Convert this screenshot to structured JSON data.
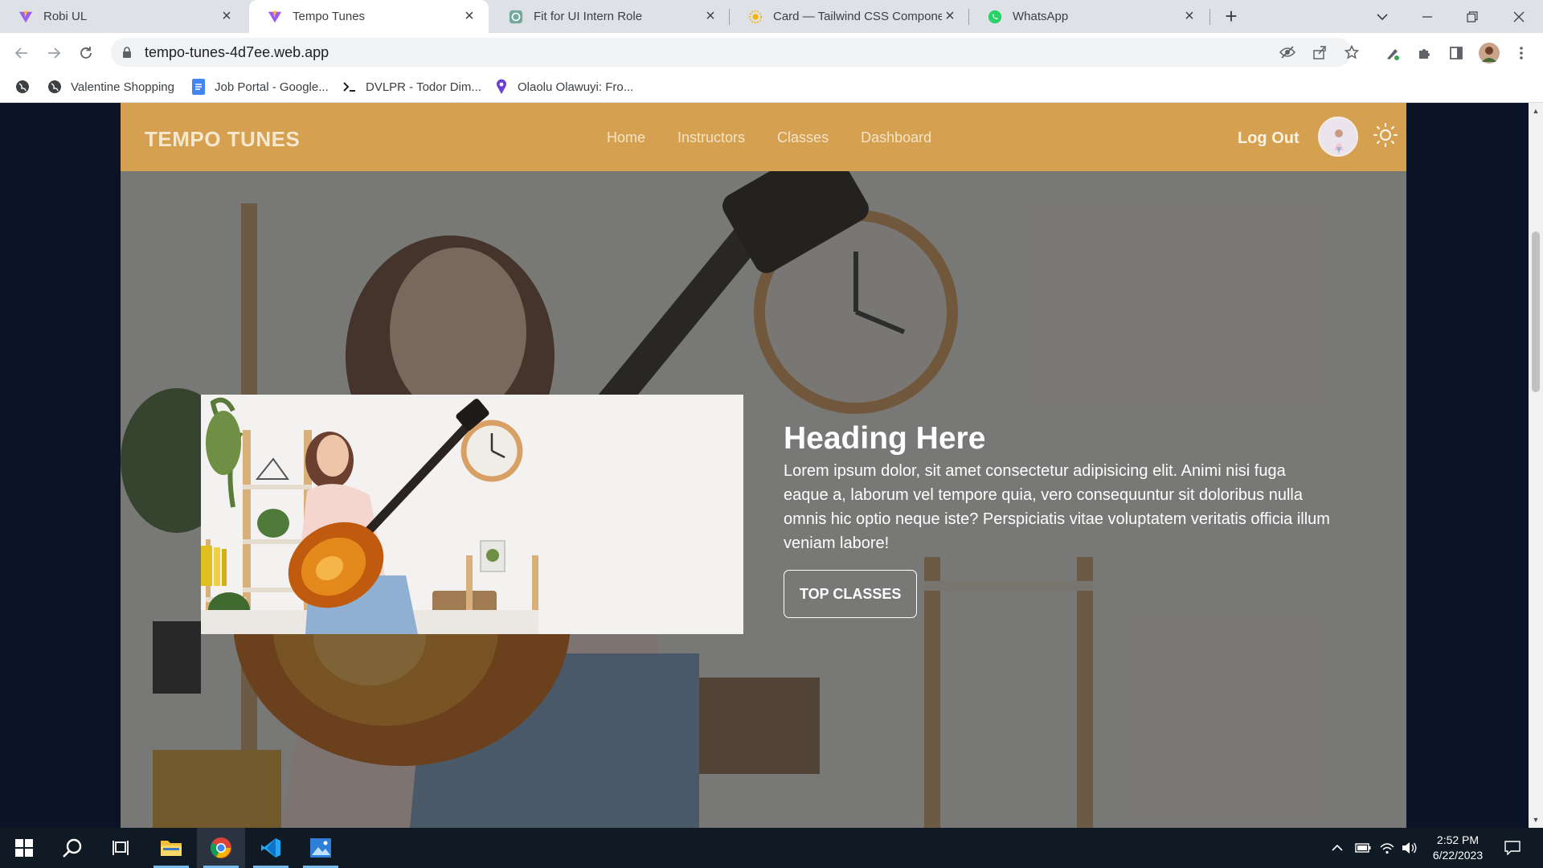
{
  "browser": {
    "tabs": [
      {
        "label": "Robi UL",
        "icon": "vite-icon"
      },
      {
        "label": "Tempo Tunes",
        "icon": "vite-icon",
        "active": true
      },
      {
        "label": "Fit for UI Intern Role",
        "icon": "chatgpt-icon"
      },
      {
        "label": "Card — Tailwind CSS Components",
        "icon": "daisyui-icon"
      },
      {
        "label": "WhatsApp",
        "icon": "whatsapp-icon"
      }
    ],
    "url": "tempo-tunes-4d7ee.web.app",
    "bookmarks": [
      {
        "label": "",
        "icon": "globe-icon"
      },
      {
        "label": "Valentine Shopping",
        "icon": "globe-icon"
      },
      {
        "label": "Job Portal - Google...",
        "icon": "docs-icon"
      },
      {
        "label": "DVLPR - Todor Dim...",
        "icon": "terminal-icon"
      },
      {
        "label": "Olaolu Olawuyi: Fro...",
        "icon": "location-icon"
      }
    ]
  },
  "site": {
    "logo": "TEMPO TUNES",
    "nav": [
      "Home",
      "Instructors",
      "Classes",
      "Dashboard"
    ],
    "logout": "Log Out",
    "accent": "#d6a051"
  },
  "hero": {
    "title": "Heading Here",
    "body": "Lorem ipsum dolor, sit amet consectetur adipisicing elit. Animi nisi fuga eaque a, laborum vel tempore quia, vero consequuntur sit doloribus nulla omnis hic optio neque iste? Perspiciatis vitae voluptatem veritatis officia illum veniam labore!",
    "button": "TOP CLASSES"
  },
  "taskbar": {
    "time": "2:52 PM",
    "date": "6/22/2023"
  }
}
